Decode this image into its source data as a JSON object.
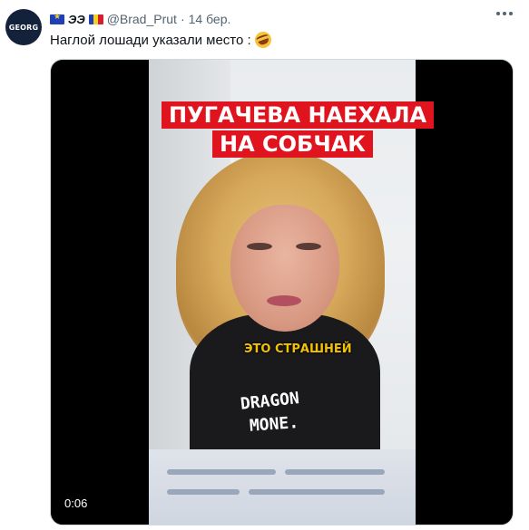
{
  "author": {
    "avatar_text": "GEORG",
    "handle": "@Brad_Prut",
    "name_letters": "ЭЭ",
    "separator": "·",
    "date": "14 бер."
  },
  "tweet": {
    "text": "Наглой лошади указали место :"
  },
  "video": {
    "title_line1": "ПУГАЧЕВА НАЕХАЛА",
    "title_line2": "НА СОБЧАК",
    "caption": "ЭТО СТРАШНЕЙ",
    "watermark_line1": "DRAGON",
    "watermark_line2": "MONE.",
    "timestamp": "0:06"
  },
  "icons": {
    "more": "more-horizontal-icon",
    "flag1": "eu-flag-icon",
    "flag2": "romania-flag-icon",
    "emoji": "rofl-emoji-icon"
  },
  "colors": {
    "banner_red": "#e0141e",
    "caption_yellow": "#f2c200",
    "secondary_text": "#536471"
  }
}
